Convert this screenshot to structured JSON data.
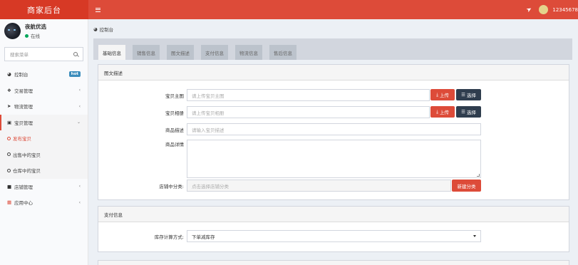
{
  "header": {
    "logo": "商家后台",
    "user_name": "12345678"
  },
  "sidebar": {
    "user": {
      "name": "夜航优选",
      "status": "在线"
    },
    "search_placeholder": "搜索菜单",
    "items": [
      {
        "label": "控制台",
        "badge": "hot"
      },
      {
        "label": "交易管理"
      },
      {
        "label": "物流管理"
      },
      {
        "label": "宝贝管理"
      },
      {
        "label": "发布宝贝"
      },
      {
        "label": "出售中的宝贝"
      },
      {
        "label": "仓库中的宝贝"
      },
      {
        "label": "店铺管理"
      },
      {
        "label": "应用中心"
      }
    ]
  },
  "breadcrumb": "控制台",
  "tabs": [
    "基础信息",
    "销售信息",
    "图文描述",
    "支付信息",
    "物流信息",
    "售后信息"
  ],
  "section_product": {
    "title": "图文描述",
    "main_image_label": "宝贝主图",
    "main_image_placeholder": "请上传宝贝主图",
    "gallery_label": "宝贝相册",
    "gallery_placeholder": "请上传宝贝相册",
    "desc_label": "商品描述",
    "desc_placeholder": "请输入宝贝描述",
    "detail_label": "商品详情",
    "category_label": "店铺中分类:",
    "category_placeholder": "点击选择店铺分类",
    "upload_label": "上传",
    "choose_label": "选择",
    "new_category_label": "新建分类"
  },
  "section_payment": {
    "title": "支付信息",
    "stock_label": "库存计算方式:",
    "stock_value": "下单减库存"
  }
}
